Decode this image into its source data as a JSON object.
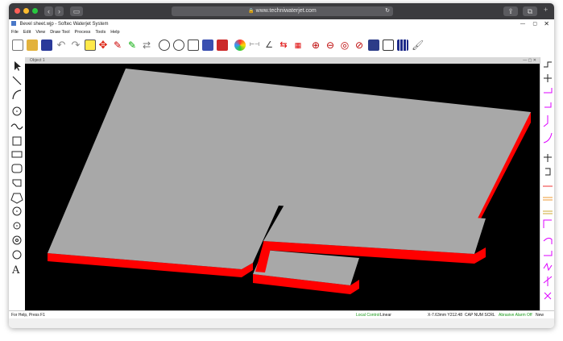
{
  "browser": {
    "url": "www.techniwaterjet.com"
  },
  "app": {
    "title": "Bevel sheet.wjp - Softec Waterjet System",
    "menu": [
      "File",
      "Edit",
      "View",
      "Draw Tool",
      "Process",
      "Tools",
      "Help"
    ],
    "document_tab": "Object 1"
  },
  "status": {
    "help": "For Help, Press F1",
    "control": "Local Control",
    "mode": "Linear",
    "coords": "X-7.63mm Y212.48",
    "keys": "CAP NUM SCRL",
    "abrasive": "Abrasive Alarm Off",
    "state": "New"
  },
  "colors": {
    "part_top": "#a8a8a8",
    "part_edge": "#ff0000",
    "canvas": "#000000"
  }
}
